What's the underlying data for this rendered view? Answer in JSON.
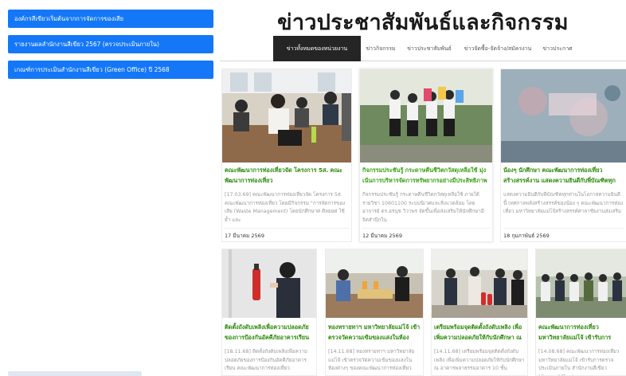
{
  "sidebar": {
    "items": [
      {
        "label": "องค์กรสีเขียวเริ่มต้นจากการจัดการของเสีย"
      },
      {
        "label": "รายงานผลสำนักงานสีเขียว 2567 (ตรวจประเมินภายใน)"
      },
      {
        "label": "เกณฑ์การประเมินสำนักงานสีเขียว (Green Office) ปี 2568"
      }
    ],
    "accent_color": "#1477f8"
  },
  "header": {
    "title": "ข่าวประชาสัมพันธ์และกิจกรรม"
  },
  "tabs": [
    {
      "label": "ข่าวทั้งหมดของหน่วยงาน",
      "active": true
    },
    {
      "label": "ข่าวกิจกรรม",
      "active": false
    },
    {
      "label": "ข่าวประชาสัมพันธ์",
      "active": false
    },
    {
      "label": "ข่าวจัดซื้อ-จัดจ้าง/สมัครงาน",
      "active": false
    },
    {
      "label": "ข่าวประกาศ",
      "active": false
    }
  ],
  "cards": [
    {
      "title": "คณะพัฒนาการท่องเที่ยวจัด โครงการ 5ส. คณะพัฒนาการท่องเที่ยว",
      "excerpt": "[17.03.69] คณะพัฒนาการท่องเที่ยวจัด โครงการ 5ส. คณะพัฒนาการท่องเที่ยว โดยมีกิจกรรม \"การจัดการของเสีย (Waste Management) โดยนักศึกษาศ ศิลยยศ ใช้ย้ำ และ",
      "date": "17 มีนาคม 2569"
    },
    {
      "title": "กิจกรรมประชันรู้ กระดาษคืนชีวิตกวัสดุเหลือใช้ มุ่งเน้นการบริหารจัดการทรัพยากรอย่างมีประสิทธิภาพ",
      "excerpt": "กิจกรรมประชันรู้ กระดาษคืนชีวิตกวัสดุเหลือใช้ ภายใต้ รายวิชา 10601100 ระบบนิเวศและสิ่งแวดล้อม โดย อาจารย์ ดร.อรนุช วิวาพร จัดขึ้นเพื่อส่งเสริมให้นักศึกษามีจิตสำนึกใน",
      "date": "12 มีนาคม 2569"
    },
    {
      "title": "น้องๆ นักศึกษา คณะพัฒนาการท่องเที่ยว สร้างสรรค์งาน แสดงความยินดีกับพี่บัณฑิตทุกท่าน",
      "excerpt": "แสดงความยินดีกับพี่บัณฑิตทุกท่านในโอกาสความยินดีนี้ เทศกาลพลังสร้างสรรค์ของน้อง ๆ คณะพัฒนาการท่องเที่ยว มหาวิทยาลัยแม่โจ้สร้างสรรค์ศาลาชัยงานส่งเสริม",
      "date": "18 กุมภาพันธ์ 2569"
    },
    {
      "title": "ติดตั้งถังดับเพลิงเพื่อความปลอดภัยของการป้องกันอัคคีภัยอาคารเรียน",
      "excerpt": "[18.11.68] ติดตั้งถังดับเพลิงเพื่อความปลอดภัยของการป้องกันอัคคีภัยอาคารเรียน คณะพัฒนาการท่องเที่ยว",
      "date": ""
    },
    {
      "title": "ทองทรายทาฯ มหาวิทยาลัยแม่โจ้ เข้าตรวจวัดความเข้มของแสงในห้องต่างๆ",
      "excerpt": "[14.11.68] ทองทรายทาฯ มหาวิทยาลัยแม่โจ้ เข้าตรวจวัดความเข้มของแสงในห้องต่างๆ ของคณะพัฒนาการท่องเที่ยว",
      "date": ""
    },
    {
      "title": "เตรียมพร้อมจุดติดตั้งถังดับเพลิง เพื่อเพิ่มความปลอดภัยให้กับนักศึกษา ณ อา",
      "excerpt": "[14.11.68] เตรียมพร้อมจุดติดตั้งถังดับเพลิง เพื่อเพิ่มความปลอดภัยให้กับนักศึกษา ณ อาคารพลาธรรมอาคาร 10 ชั้น",
      "date": ""
    },
    {
      "title": "คณะพัฒนาการท่องเที่ยว มหาวิทยาลัยแม่โจ้ เข้ารับการตรวจประเมินภายใน",
      "excerpt": "[14.08.68] คณะพัฒนาการท่องเที่ยว มหาวิทยาลัยแม่โจ้ เข้ารับการตรวจประเมินภายใน สำนักงานสีเขียว (Green Office)",
      "date": ""
    }
  ]
}
